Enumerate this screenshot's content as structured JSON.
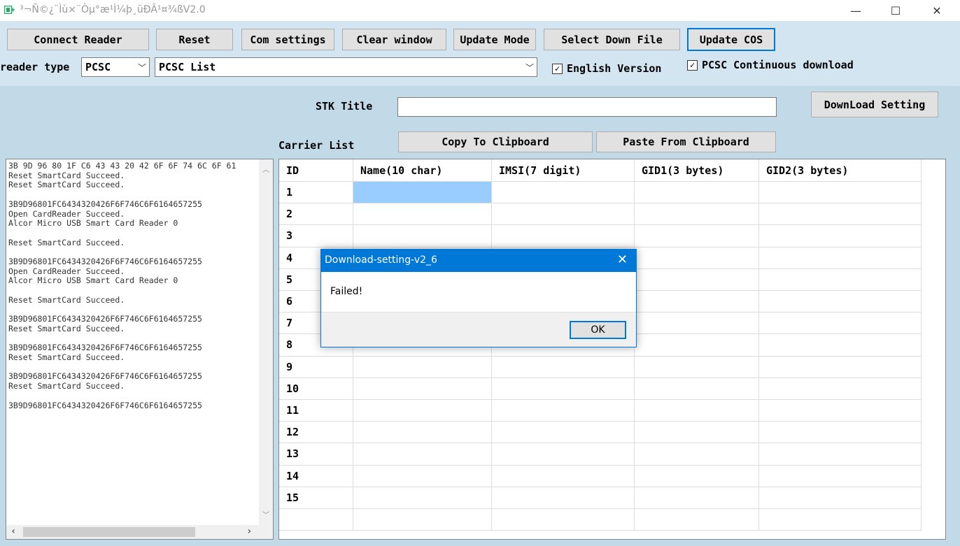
{
  "window": {
    "title": "³¬Ñ©¿¨Ìù×¨Òµ°æ¹Ì¼þ¸üÐÂ¹¤¾ßV2.0",
    "icon": "app-icon",
    "minimize_glyph": "—",
    "maximize_glyph": "☐",
    "close_glyph": "✕"
  },
  "toolbar": {
    "buttons": [
      "Connect Reader",
      "Reset",
      "Com settings",
      "Clear window",
      "Update Mode",
      "Select Down File",
      "Update COS"
    ],
    "reader_type_label": "reader type",
    "reader_type_value": "PCSC",
    "reader_list_value": "PCSC List",
    "english_version_label": "English Version",
    "english_version_checked": true,
    "pcsc_continuous_label": "PCSC Continuous download",
    "pcsc_continuous_checked": true
  },
  "stk": {
    "title_label": "STK Title",
    "title_value": "",
    "download_setting_label": "DownLoad Setting"
  },
  "carrier": {
    "list_label": "Carrier List",
    "copy_button": "Copy To Clipboard",
    "paste_button": "Paste From Clipboard",
    "columns": [
      "ID",
      "Name(10 char)",
      "IMSI(7 digit)",
      "GID1(3 bytes)",
      "GID2(3 bytes)"
    ],
    "rows": [
      "1",
      "2",
      "3",
      "4",
      "5",
      "6",
      "7",
      "8",
      "9",
      "10",
      "11",
      "12",
      "13",
      "14",
      "15"
    ],
    "selection_color": "#99ccff"
  },
  "log": {
    "lines": [
      "3B 9D 96 80 1F C6 43 43 20 42 6F 6F 74 6C 6F 61",
      "Reset SmartCard Succeed.",
      "Reset SmartCard Succeed.",
      "",
      "3B9D96801FC6434320426F6F746C6F6164657255",
      "Open CardReader Succeed.",
      "Alcor Micro USB Smart Card Reader 0",
      "",
      "Reset SmartCard Succeed.",
      "",
      "3B9D96801FC6434320426F6F746C6F6164657255",
      "Open CardReader Succeed.",
      "Alcor Micro USB Smart Card Reader 0",
      "",
      "Reset SmartCard Succeed.",
      "",
      "3B9D96801FC6434320426F6F746C6F6164657255",
      "Reset SmartCard Succeed.",
      "",
      "3B9D96801FC6434320426F6F746C6F6164657255",
      "Reset SmartCard Succeed.",
      "",
      "3B9D96801FC6434320426F6F746C6F6164657255",
      "Reset SmartCard Succeed.",
      "",
      "3B9D96801FC6434320426F6F746C6F6164657255"
    ]
  },
  "dialog": {
    "title": "Download-setting-v2_6",
    "message": "Failed!",
    "ok_label": "OK",
    "close_glyph": "✕"
  },
  "colors": {
    "background": "#c2dae7",
    "toolbar": "#d2e5f1",
    "accent": "#0078d7"
  }
}
